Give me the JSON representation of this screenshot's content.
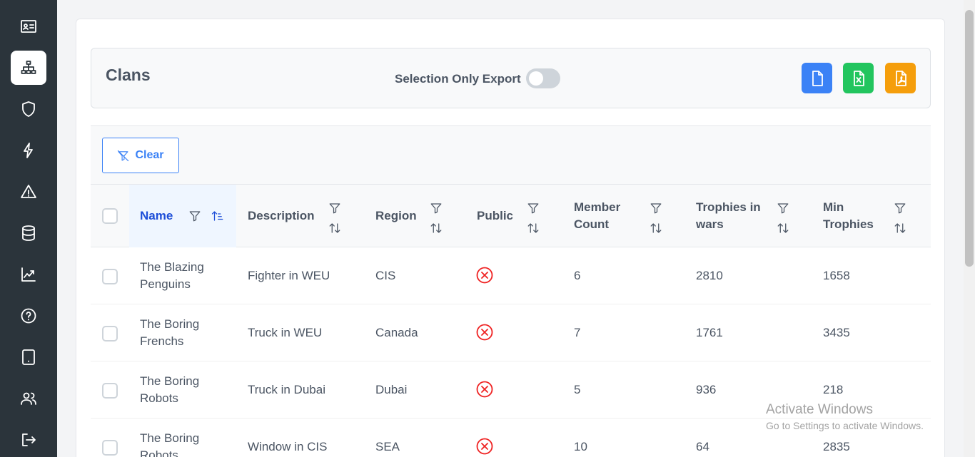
{
  "sidebar": {
    "items": [
      {
        "icon": "id-card-icon"
      },
      {
        "icon": "sitemap-icon",
        "active": true
      },
      {
        "icon": "shield-icon"
      },
      {
        "icon": "bolt-icon"
      },
      {
        "icon": "warning-icon"
      },
      {
        "icon": "database-icon"
      },
      {
        "icon": "chart-line-icon"
      },
      {
        "icon": "help-icon"
      },
      {
        "icon": "tablet-icon"
      },
      {
        "icon": "users-icon"
      },
      {
        "icon": "sign-out-icon"
      }
    ]
  },
  "page": {
    "title": "Clans",
    "export_label": "Selection Only Export",
    "export_toggle_on": false
  },
  "export_buttons": [
    {
      "name": "csv",
      "icon": "file-icon",
      "color": "#3b82f6"
    },
    {
      "name": "excel",
      "icon": "file-excel-icon",
      "color": "#22c55e"
    },
    {
      "name": "pdf",
      "icon": "file-pdf-icon",
      "color": "#f59e0b"
    }
  ],
  "filter": {
    "clear_label": "Clear"
  },
  "table": {
    "columns": [
      {
        "label": "Name"
      },
      {
        "label": "Description"
      },
      {
        "label": "Region"
      },
      {
        "label": "Public"
      },
      {
        "label_line1": "Member",
        "label_line2": "Count"
      },
      {
        "label_line1": "Trophies in",
        "label_line2": "wars"
      },
      {
        "label_line1": "Min",
        "label_line2": "Trophies"
      }
    ],
    "rows": [
      {
        "name_line1": "The Blazing",
        "name_line2": "Penguins",
        "description": "Fighter in WEU",
        "region": "CIS",
        "public": false,
        "member_count": "6",
        "trophies_in_wars": "2810",
        "min_trophies": "1658"
      },
      {
        "name_line1": "The Boring",
        "name_line2": "Frenchs",
        "description": "Truck in WEU",
        "region": "Canada",
        "public": false,
        "member_count": "7",
        "trophies_in_wars": "1761",
        "min_trophies": "3435"
      },
      {
        "name_line1": "The Boring",
        "name_line2": "Robots",
        "description": "Truck in Dubai",
        "region": "Dubai",
        "public": false,
        "member_count": "5",
        "trophies_in_wars": "936",
        "min_trophies": "218"
      },
      {
        "name_line1": "The Boring",
        "name_line2": "Robots",
        "description": "Window in CIS",
        "region": "SEA",
        "public": false,
        "member_count": "10",
        "trophies_in_wars": "64",
        "min_trophies": "2835"
      }
    ]
  },
  "watermark": {
    "title": "Activate Windows",
    "subtitle": "Go to Settings to activate Windows."
  }
}
